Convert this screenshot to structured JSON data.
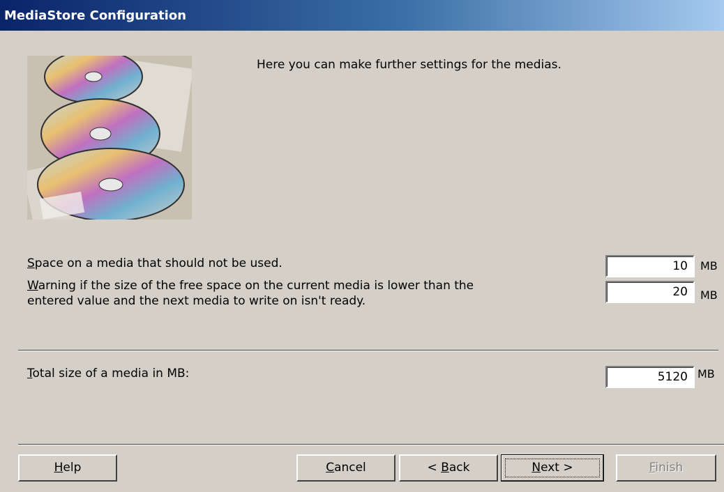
{
  "window": {
    "title": "MediaStore Configuration"
  },
  "intro": "Here you can make further settings for the medias.",
  "settings": {
    "unused_space": {
      "label_key": "S",
      "label_rest": "pace on a media that should not be used.",
      "value": "10",
      "unit": "MB"
    },
    "warning": {
      "label_key": "W",
      "label_rest": "arning if the size of the free space on the current media is lower than the",
      "label_line2": "entered value and the next media to write on isn't ready.",
      "value": "20",
      "unit": "MB"
    },
    "total_size": {
      "label_key": "T",
      "label_rest": "otal size of a media in MB:",
      "value": "5120",
      "unit": "MB"
    }
  },
  "buttons": {
    "help": {
      "key": "H",
      "rest": "elp"
    },
    "cancel": {
      "key": "C",
      "rest": "ancel"
    },
    "back": {
      "pre": "< ",
      "key": "B",
      "rest": "ack"
    },
    "next": {
      "key": "N",
      "rest": "ext >"
    },
    "finish": {
      "key": "F",
      "rest": "inish"
    }
  }
}
